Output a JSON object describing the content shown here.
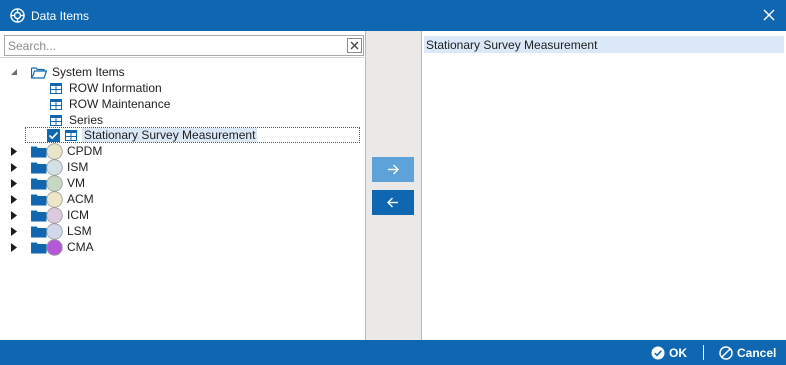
{
  "window": {
    "title": "Data Items",
    "icon": "settings-gear-icon",
    "close_icon": "close-icon"
  },
  "search": {
    "placeholder": "Search...",
    "value": "",
    "clear_icon": "clear-x-icon"
  },
  "tree": {
    "root": {
      "label": "System Items",
      "icon": "folder-open-icon",
      "expanded": true,
      "children": [
        {
          "label": "ROW Information",
          "icon": "table-icon",
          "checked": false
        },
        {
          "label": "ROW Maintenance",
          "icon": "table-icon",
          "checked": false
        },
        {
          "label": "Series",
          "icon": "table-icon",
          "checked": false
        },
        {
          "label": "Stationary Survey Measurement",
          "icon": "table-icon",
          "checked": true,
          "selected": true
        }
      ]
    },
    "groups": [
      {
        "label": "CPDM",
        "color": "#e8e5c9"
      },
      {
        "label": "ISM",
        "color": "#d4e1e4"
      },
      {
        "label": "VM",
        "color": "#c6d8c2"
      },
      {
        "label": "ACM",
        "color": "#eee6c9"
      },
      {
        "label": "ICM",
        "color": "#ddc9de"
      },
      {
        "label": "LSM",
        "color": "#d3d7ea"
      },
      {
        "label": "CMA",
        "color": "#b558d6"
      }
    ],
    "colors": {
      "folder": "#0f67b1",
      "table_icon": "#0f67b1"
    }
  },
  "transfer": {
    "add_icon": "arrow-right-icon",
    "remove_icon": "arrow-left-icon"
  },
  "selected_items": [
    "Stationary Survey Measurement"
  ],
  "footer": {
    "ok_label": "OK",
    "ok_icon": "check-circle-icon",
    "cancel_label": "Cancel",
    "cancel_icon": "cancel-circle-icon"
  },
  "colors": {
    "accent": "#0f67b1",
    "accent_light": "#5da2d8",
    "selection": "#dbe8f7",
    "middle_bg": "#ebe8e8"
  }
}
